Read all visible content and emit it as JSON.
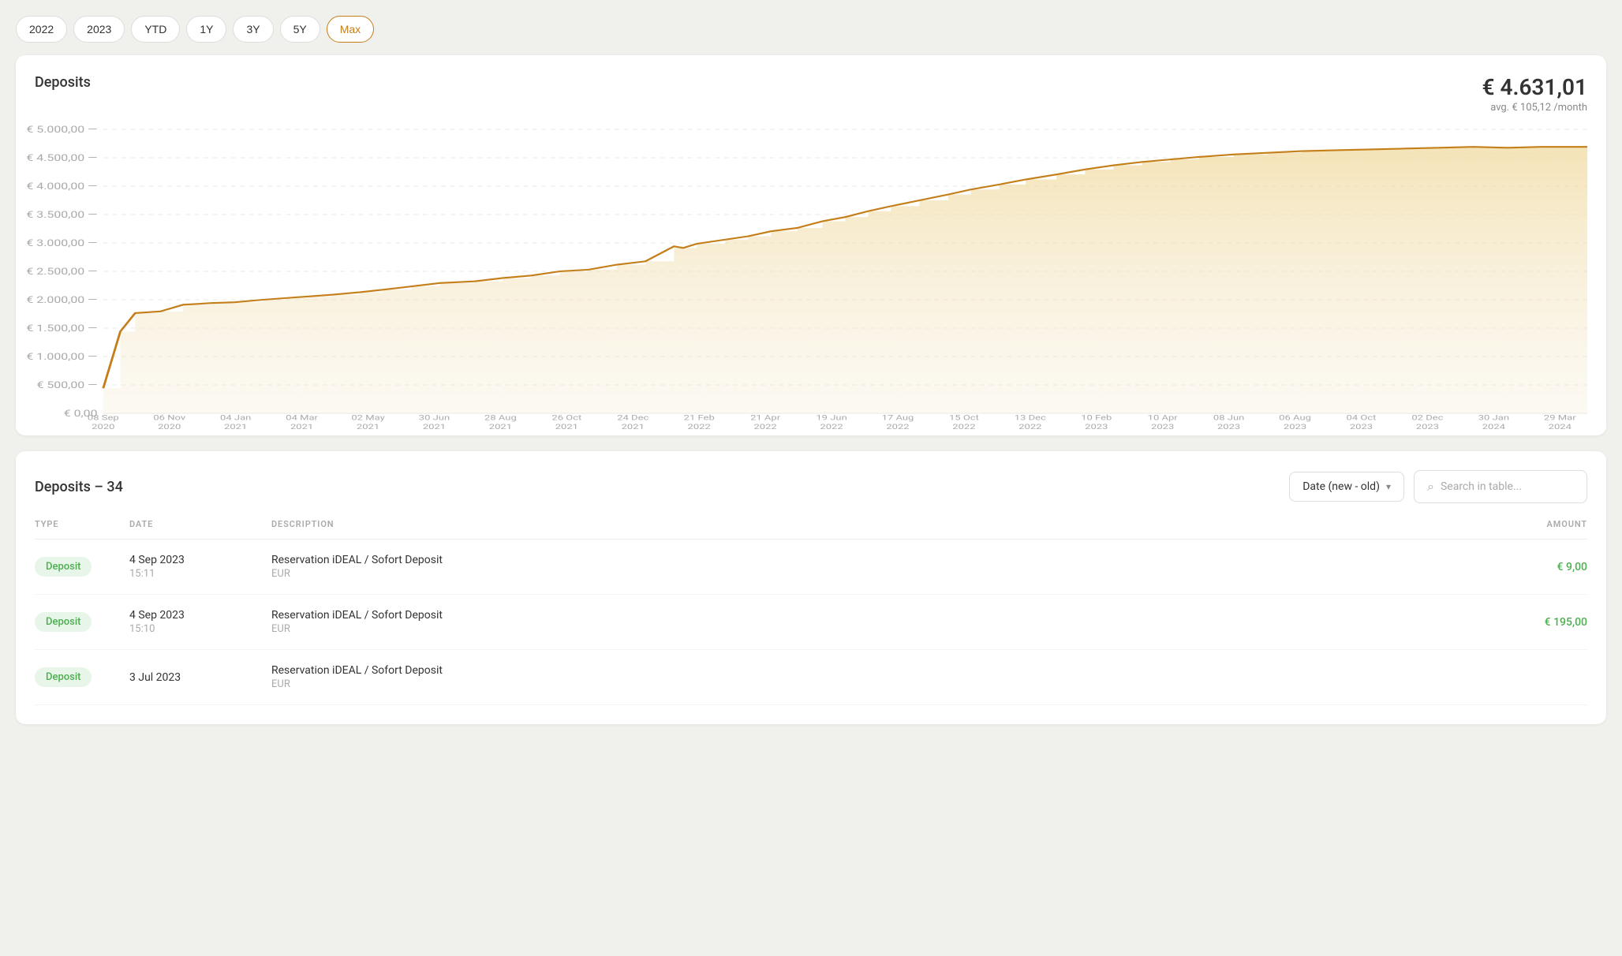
{
  "periods": [
    {
      "label": "2022",
      "active": false
    },
    {
      "label": "2023",
      "active": false
    },
    {
      "label": "YTD",
      "active": false
    },
    {
      "label": "1Y",
      "active": false
    },
    {
      "label": "3Y",
      "active": false
    },
    {
      "label": "5Y",
      "active": false
    },
    {
      "label": "Max",
      "active": true
    }
  ],
  "chart": {
    "title": "Deposits",
    "total_amount": "€ 4.631,01",
    "avg_label": "avg. € 105,12 /month",
    "y_labels": [
      "€ 5.000,00",
      "€ 4.500,00",
      "€ 4.000,00",
      "€ 3.500,00",
      "€ 3.000,00",
      "€ 2.500,00",
      "€ 2.000,00",
      "€ 1.500,00",
      "€ 1.000,00",
      "€ 500,00",
      "€ 0,00"
    ],
    "x_labels": [
      "08 Sep\n2020",
      "06 Nov\n2020",
      "04 Jan\n2021",
      "04 Mar\n2021",
      "02 May\n2021",
      "30 Jun\n2021",
      "28 Aug\n2021",
      "26 Oct\n2021",
      "24 Dec\n2021",
      "21 Feb\n2022",
      "21 Apr\n2022",
      "19 Jun\n2022",
      "17 Aug\n2022",
      "15 Oct\n2022",
      "13 Dec\n2022",
      "10 Feb\n2023",
      "10 Apr\n2023",
      "08 Jun\n2023",
      "06 Aug\n2023",
      "04 Oct\n2023",
      "02 Dec\n2023",
      "30 Jan\n2024",
      "29 Mar\n2024"
    ]
  },
  "table": {
    "title": "Deposits",
    "count": 34,
    "sort_label": "Date (new - old)",
    "search_placeholder": "Search in table...",
    "columns": {
      "type": "TYPE",
      "date": "DATE",
      "description": "DESCRIPTION",
      "amount": "AMOUNT"
    },
    "rows": [
      {
        "type": "Deposit",
        "type_class": "badge-deposit",
        "date": "4 Sep 2023",
        "time": "15:11",
        "description": "Reservation iDEAL / Sofort Deposit",
        "desc_sub": "EUR",
        "amount": "€ 9,00",
        "amount_class": "green"
      },
      {
        "type": "Deposit",
        "type_class": "badge-deposit",
        "date": "4 Sep 2023",
        "time": "15:10",
        "description": "Reservation iDEAL / Sofort Deposit",
        "desc_sub": "EUR",
        "amount": "€ 195,00",
        "amount_class": "green"
      },
      {
        "type": "Deposit",
        "type_class": "badge-deposit",
        "date": "3 Jul 2023",
        "time": "",
        "description": "Reservation iDEAL / Sofort Deposit",
        "desc_sub": "EUR",
        "amount": "",
        "amount_class": "green"
      }
    ]
  }
}
